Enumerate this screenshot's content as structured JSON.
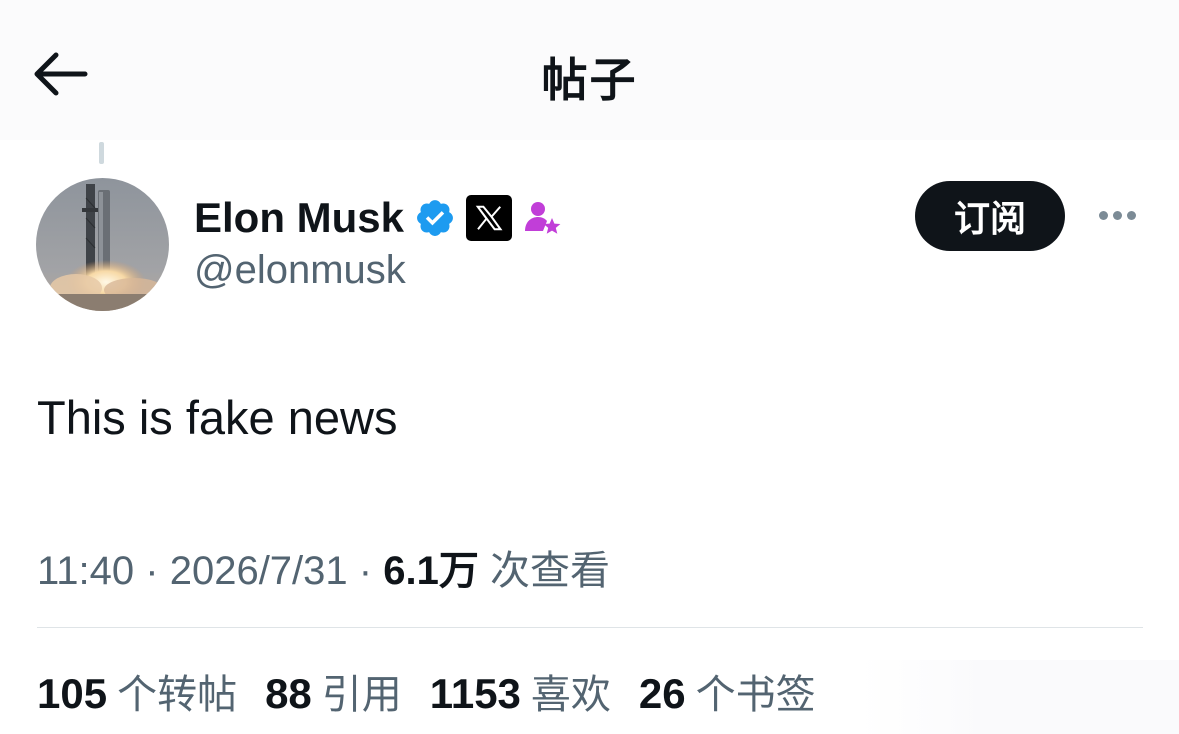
{
  "header": {
    "title": "帖子"
  },
  "author": {
    "display_name": "Elon Musk",
    "handle": "@elonmusk",
    "badges": [
      "verified-check-icon",
      "x-affiliate-badge-icon",
      "subscriber-star-icon"
    ],
    "subscribe_label": "订阅"
  },
  "post": {
    "text": "This is fake news",
    "time": "11:40",
    "date": "2026/7/31",
    "views_count": "6.1万",
    "views_label": "次查看"
  },
  "stats": [
    {
      "count": "105",
      "label": "个转帖"
    },
    {
      "count": "88",
      "label": "引用"
    },
    {
      "count": "1153",
      "label": "喜欢"
    },
    {
      "count": "26",
      "label": "个书签"
    }
  ],
  "colors": {
    "primary_text": "#0f1419",
    "secondary_text": "#536471",
    "verified_blue": "#1d9bf0",
    "subscriber_purple": "#c13ed8",
    "divider": "#dfe4e7"
  }
}
